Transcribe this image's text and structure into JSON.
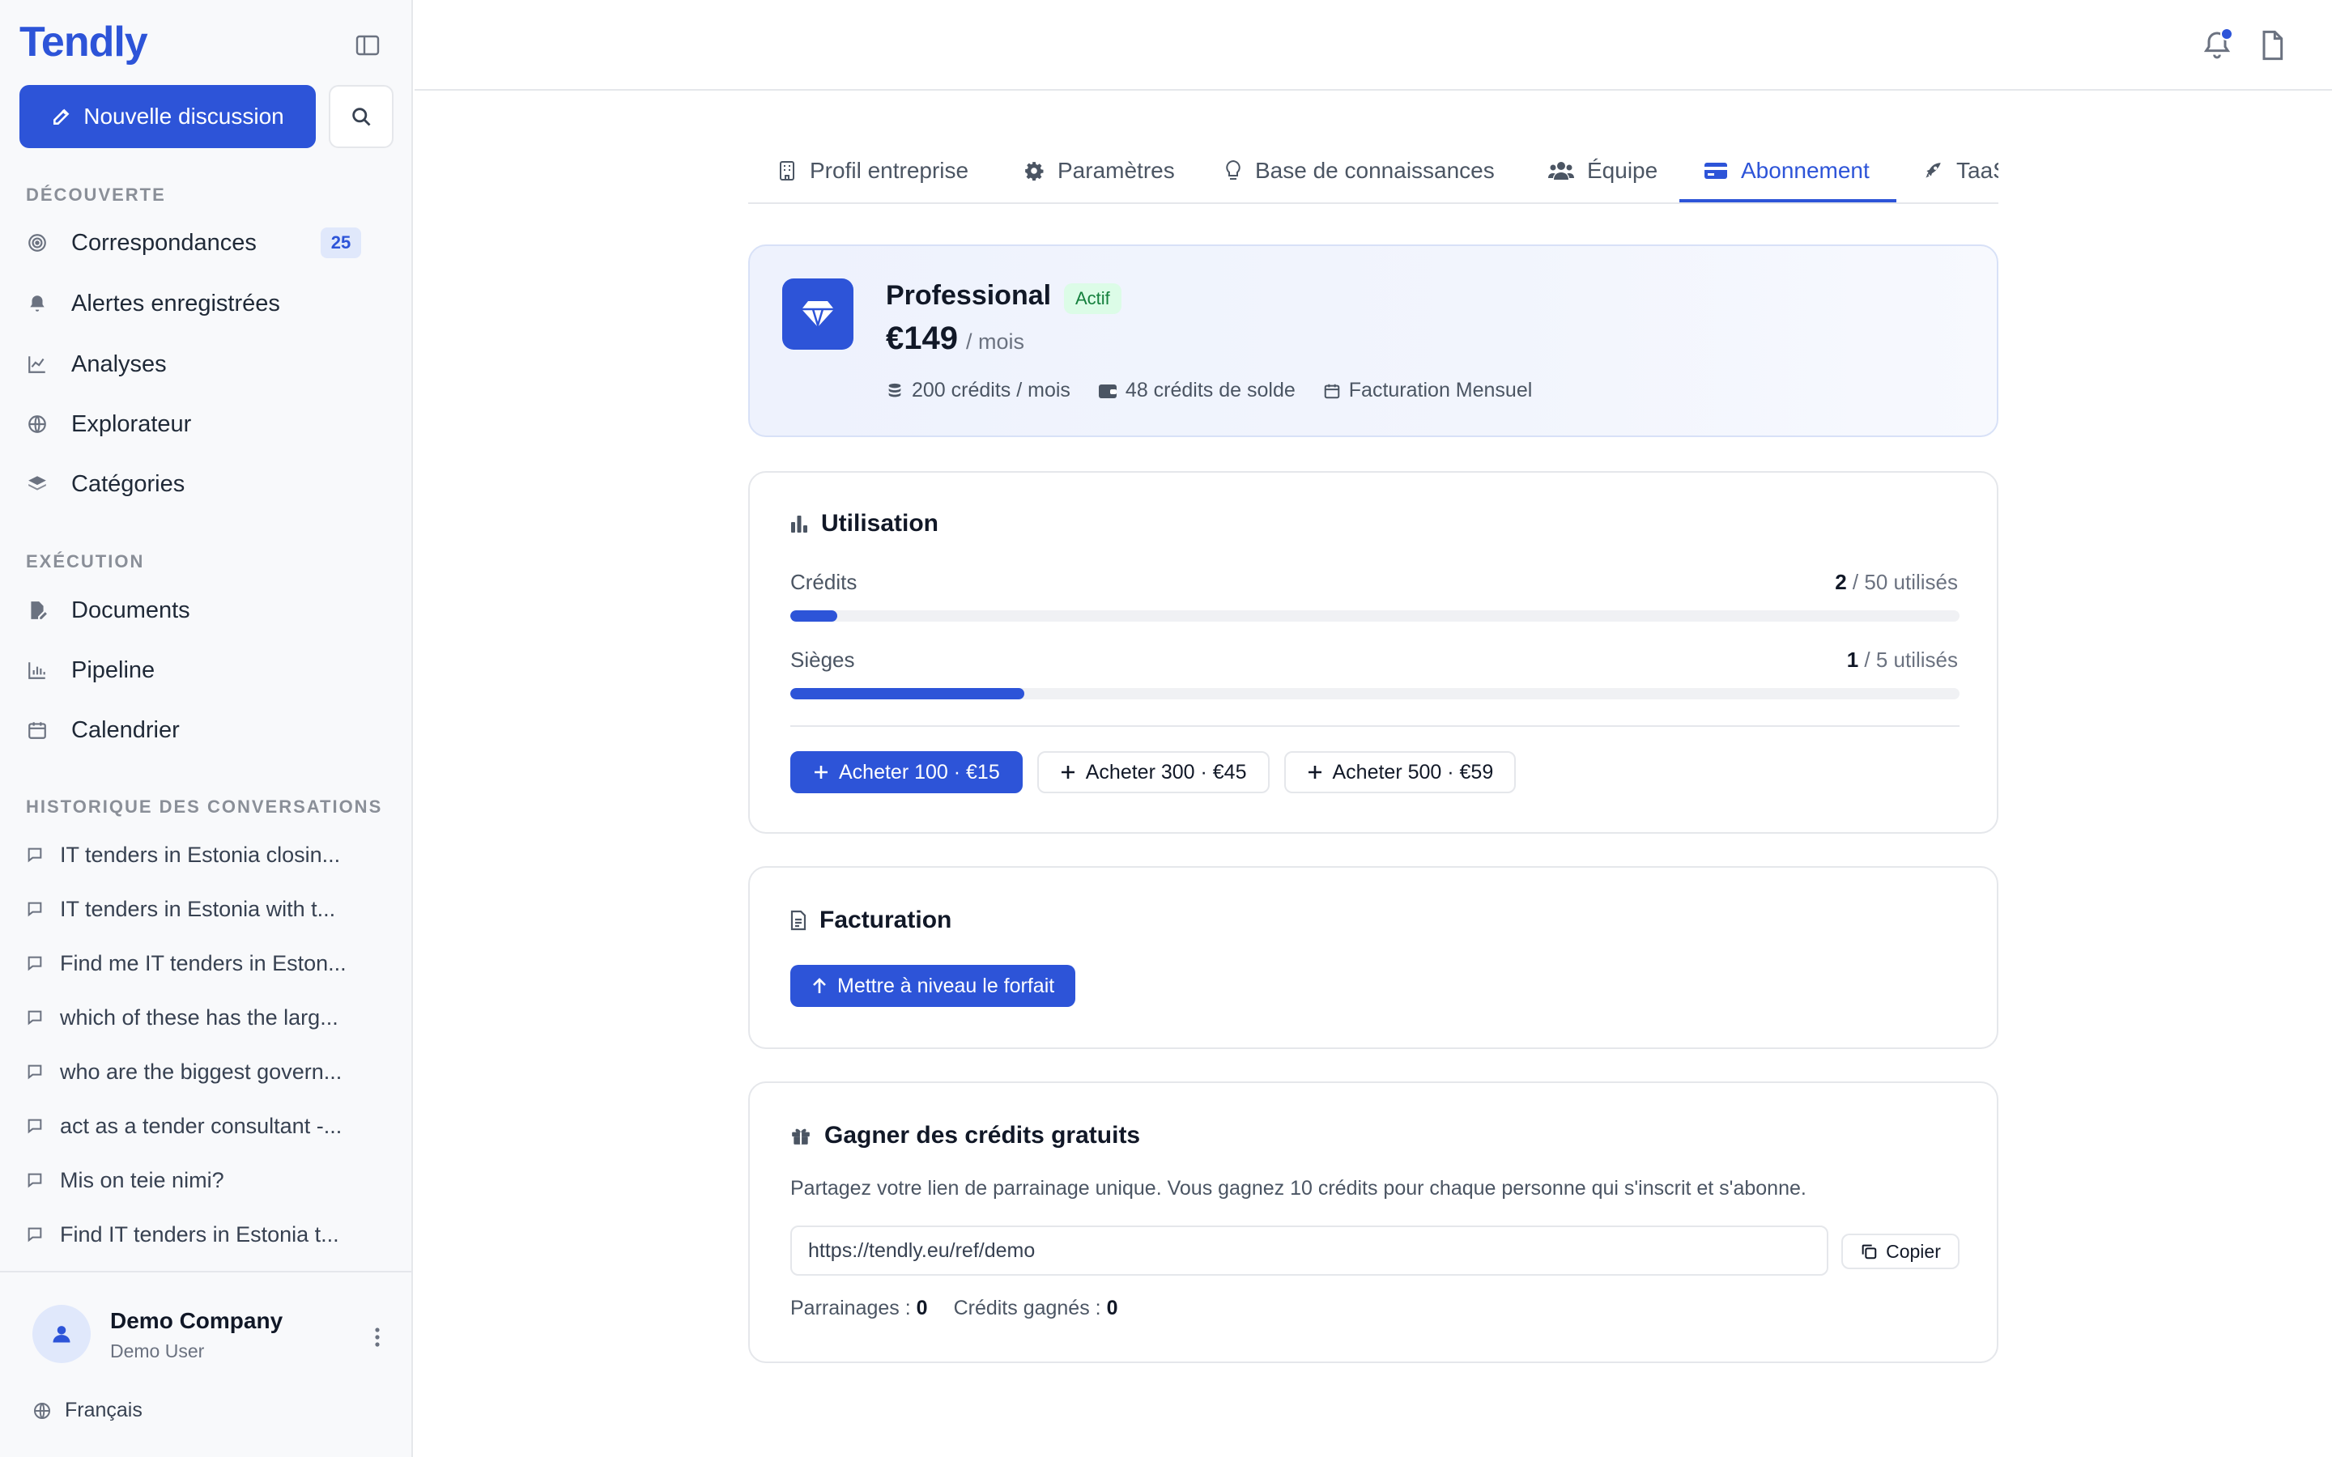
{
  "app": {
    "logo": "Tendly"
  },
  "sidebar": {
    "new_chat_label": "Nouvelle discussion",
    "sections": [
      {
        "label": "DÉCOUVERTE",
        "items": [
          {
            "label": "Correspondances",
            "icon": "target-icon",
            "badge": "25"
          },
          {
            "label": "Alertes enregistrées",
            "icon": "bell-icon"
          },
          {
            "label": "Analyses",
            "icon": "line-chart-icon"
          },
          {
            "label": "Explorateur",
            "icon": "globe-icon"
          },
          {
            "label": "Catégories",
            "icon": "layers-icon"
          }
        ]
      },
      {
        "label": "EXÉCUTION",
        "items": [
          {
            "label": "Documents",
            "icon": "file-edit-icon"
          },
          {
            "label": "Pipeline",
            "icon": "bar-chart-icon"
          },
          {
            "label": "Calendrier",
            "icon": "calendar-icon"
          }
        ]
      }
    ],
    "history_label": "HISTORIQUE DES CONVERSATIONS",
    "history": [
      "IT tenders in Estonia closin...",
      "IT tenders in Estonia with t...",
      "Find me IT tenders in Eston...",
      "which of these has the larg...",
      "who are the biggest govern...",
      "act as a tender consultant -...",
      "Mis on teie nimi?",
      "Find IT tenders in Estonia t..."
    ],
    "footer": {
      "company": "Demo Company",
      "user": "Demo User",
      "language": "Français"
    }
  },
  "tabs": [
    {
      "label": "Profil entreprise",
      "icon": "building-icon"
    },
    {
      "label": "Paramètres",
      "icon": "gear-icon"
    },
    {
      "label": "Base de connaissances",
      "icon": "lightbulb-icon"
    },
    {
      "label": "Équipe",
      "icon": "users-icon"
    },
    {
      "label": "Abonnement",
      "icon": "credit-card-icon",
      "active": true
    },
    {
      "label": "TaaS",
      "icon": "rocket-icon"
    }
  ],
  "plan": {
    "name": "Professional",
    "status": "Actif",
    "price": "€149",
    "period": "/ mois",
    "meta": [
      "200 crédits / mois",
      "48 crédits de solde",
      "Facturation Mensuel"
    ]
  },
  "usage": {
    "title": "Utilisation",
    "credits": {
      "label": "Crédits",
      "used": "2",
      "suffix": "/ 50 utilisés",
      "fraction": 0.04
    },
    "seats": {
      "label": "Sièges",
      "used": "1",
      "suffix": "/ 5 utilisés",
      "fraction": 0.2
    },
    "buy": [
      "Acheter 100 · €15",
      "Acheter 300 · €45",
      "Acheter 500 · €59"
    ]
  },
  "billing": {
    "title": "Facturation",
    "upgrade_label": "Mettre à niveau le forfait"
  },
  "referral": {
    "title": "Gagner des crédits gratuits",
    "description": "Partagez votre lien de parrainage unique. Vous gagnez 10 crédits pour chaque personne qui s'inscrit et s'abonne.",
    "link": "https://tendly.eu/ref/demo",
    "copy_label": "Copier",
    "referrals_label": "Parrainages :",
    "referrals_value": "0",
    "earned_label": "Crédits gagnés :",
    "earned_value": "0"
  },
  "colors": {
    "accent": "#2d54d8",
    "status_bg": "#dcfce7",
    "status_text": "#15803d"
  }
}
